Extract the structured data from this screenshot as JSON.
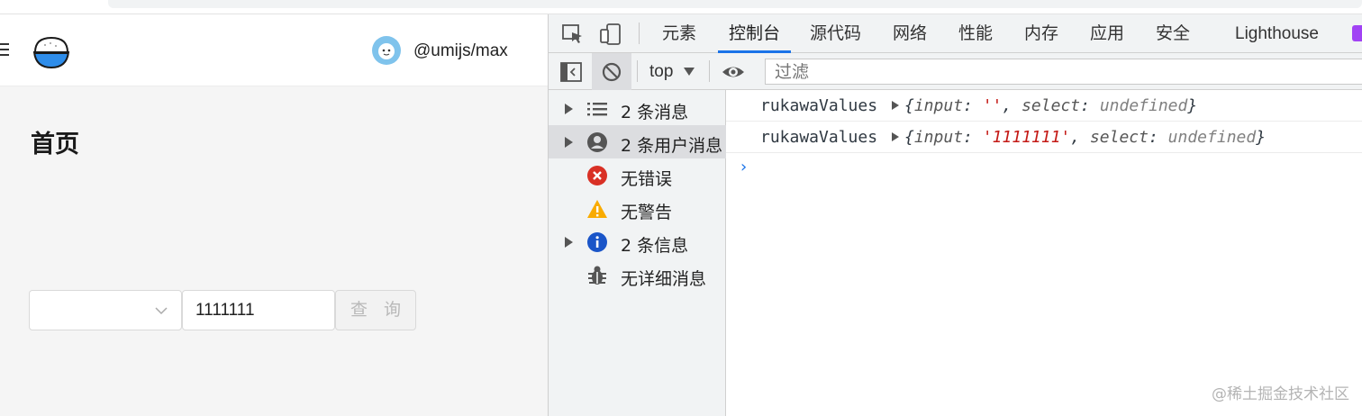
{
  "app": {
    "title": "首页",
    "user_name": "@umijs/max",
    "search": {
      "select_value": "",
      "input_value": "1111111",
      "button_label": "查 询"
    }
  },
  "devtools": {
    "tabs": [
      {
        "label": "元素"
      },
      {
        "label": "控制台"
      },
      {
        "label": "源代码"
      },
      {
        "label": "网络"
      },
      {
        "label": "性能"
      },
      {
        "label": "内存"
      },
      {
        "label": "应用"
      },
      {
        "label": "安全"
      },
      {
        "label": "Lighthouse"
      }
    ],
    "active_tab": "控制台",
    "toolbar": {
      "context": "top",
      "filter_placeholder": "过滤"
    },
    "sidebar": [
      {
        "label": "2 条消息",
        "icon": "list-icon"
      },
      {
        "label": "2 条用户消息",
        "icon": "user-icon"
      },
      {
        "label": "无错误",
        "icon": "error-icon"
      },
      {
        "label": "无警告",
        "icon": "warning-icon"
      },
      {
        "label": "2 条信息",
        "icon": "info-icon"
      },
      {
        "label": "无详细消息",
        "icon": "bug-icon"
      }
    ],
    "console_logs": [
      {
        "name": "rukawaValues",
        "open": "{",
        "k_input": "input",
        "input_value": "''",
        "k_select": "select",
        "select_value": "undefined",
        "close": "}"
      },
      {
        "name": "rukawaValues",
        "open": "{",
        "k_input": "input",
        "input_value": "'1111111'",
        "k_select": "select",
        "select_value": "undefined",
        "close": "}"
      }
    ]
  },
  "watermark": "@稀土掘金技术社区",
  "colors": {
    "accent": "#1a73e8",
    "string": "#c41a16",
    "error": "#d93025",
    "warning": "#f9ab00",
    "info": "#1a73e8"
  }
}
